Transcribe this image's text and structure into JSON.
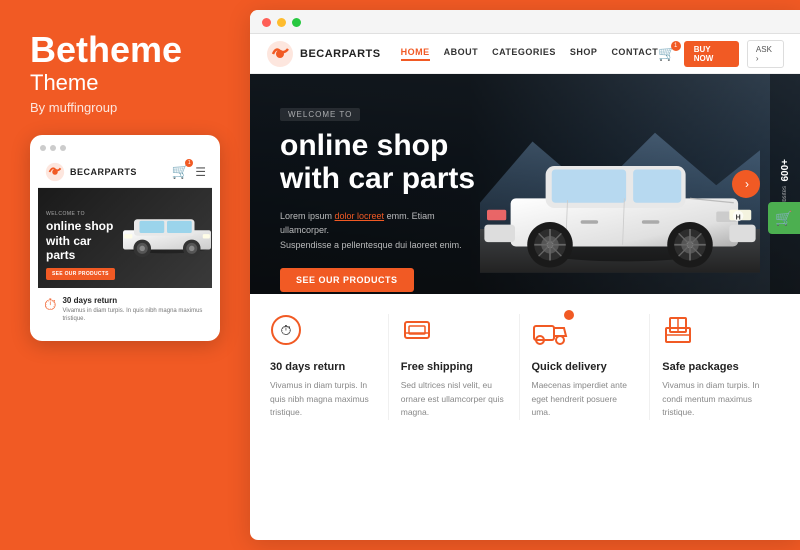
{
  "brand": {
    "name": "Betheme",
    "subtitle": "Theme",
    "by": "By muffingroup"
  },
  "mobile": {
    "logo_text": "BECARPARTS",
    "welcome": "WELCOME TO",
    "hero_title": "online shop\nwith car\nparts",
    "cta_button": "SEE OUR PRODUCTS",
    "feature_title": "30 days return",
    "feature_text": "Vivamus in diam turpis. In quis nibh magna maximus tristique."
  },
  "browser": {
    "dots": [
      "red",
      "yellow",
      "green"
    ]
  },
  "desktop": {
    "logo_text": "BECARPARTS",
    "nav_links": [
      {
        "label": "HOME",
        "active": true
      },
      {
        "label": "ABOUT",
        "active": false
      },
      {
        "label": "CATEGORIES",
        "active": false
      },
      {
        "label": "SHOP",
        "active": false
      },
      {
        "label": "CONTACT",
        "active": false
      }
    ],
    "buy_now": "BUY NOW",
    "ask": "ASK ›",
    "welcome_tag": "WELCOME TO",
    "hero_title_line1": "online shop",
    "hero_title_line2": "with car parts",
    "hero_subtitle": "Lorem ipsum dolor locreet emm. Etiam ullamcorper. Suspendisse a pellentesque dui laoreet enim.",
    "hero_cta": "SEE OUR PRODUCTS",
    "badge_number": "600+",
    "badge_text": "websites",
    "features": [
      {
        "icon": "⏱",
        "title": "30 days return",
        "text": "Vivamus in diam turpis. In quis nibh magna maximus tristique."
      },
      {
        "icon": "🖥",
        "title": "Free shipping",
        "text": "Sed ultrices nisl velit, eu ornare est ullamcorper quis magna."
      },
      {
        "icon": "🚚",
        "title": "Quick delivery",
        "text": "Maecenas imperdiet ante eget hendrerit posuere uma."
      },
      {
        "icon": "📦",
        "title": "Safe packages",
        "text": "Vivamus in diam turpis. In condi mentum maximus tristique."
      }
    ]
  }
}
